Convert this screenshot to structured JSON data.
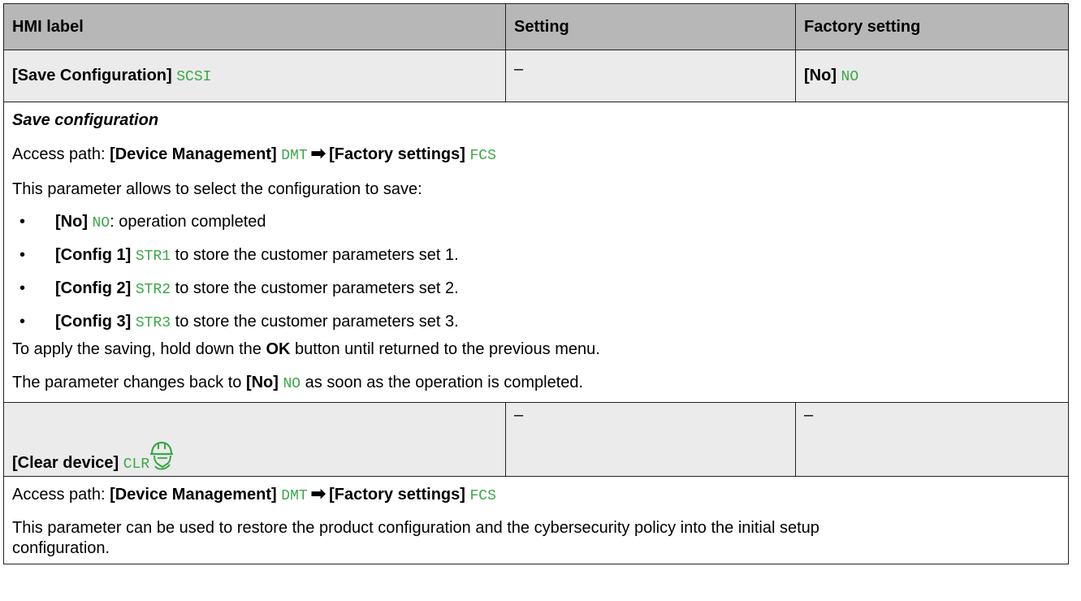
{
  "header": {
    "col1": "HMI label",
    "col2": "Setting",
    "col3": "Factory setting"
  },
  "save_config": {
    "label": "[Save Configuration]",
    "code": "SCSI",
    "setting": "–",
    "factory_label": "[No]",
    "factory_code": "NO",
    "title": "Save configuration",
    "access_prefix": "Access path:",
    "access_menu1": "[Device Management]",
    "access_code1": "DMT",
    "access_menu2": "[Factory settings]",
    "access_code2": "FCS",
    "intro": "This parameter allows to select the configuration to save:",
    "options": [
      {
        "bullet": "•",
        "label": "[No]",
        "code": "NO",
        "text": ": operation completed"
      },
      {
        "bullet": "•",
        "label": "[Config 1]",
        "code": "STR1",
        "text": " to store the customer parameters set 1."
      },
      {
        "bullet": "•",
        "label": "[Config 2]",
        "code": "STR2",
        "text": " to store the customer parameters set 2."
      },
      {
        "bullet": "•",
        "label": "[Config 3]",
        "code": "STR3",
        "text": " to store the customer parameters set 3."
      }
    ],
    "apply_before": "To apply the saving, hold down the ",
    "apply_bold": "OK",
    "apply_after": " button until returned to the previous menu.",
    "changes_before": "The parameter changes back to ",
    "changes_label": "[No]",
    "changes_code": "NO",
    "changes_after": " as soon as the operation is completed."
  },
  "clear_device": {
    "label": "[Clear device]",
    "code": "CLR",
    "icon": "expert-helmet-icon",
    "setting": "–",
    "factory": "–",
    "access_prefix": "Access path:",
    "access_menu1": "[Device Management]",
    "access_code1": "DMT",
    "access_menu2": "[Factory settings]",
    "access_code2": "FCS",
    "description": "This parameter can be used to restore the product configuration and the cybersecurity policy into the initial setup configuration."
  },
  "colors": {
    "code_green": "#3aa845",
    "header_bg": "#b7b7b7",
    "row_bg": "#ebebeb"
  }
}
